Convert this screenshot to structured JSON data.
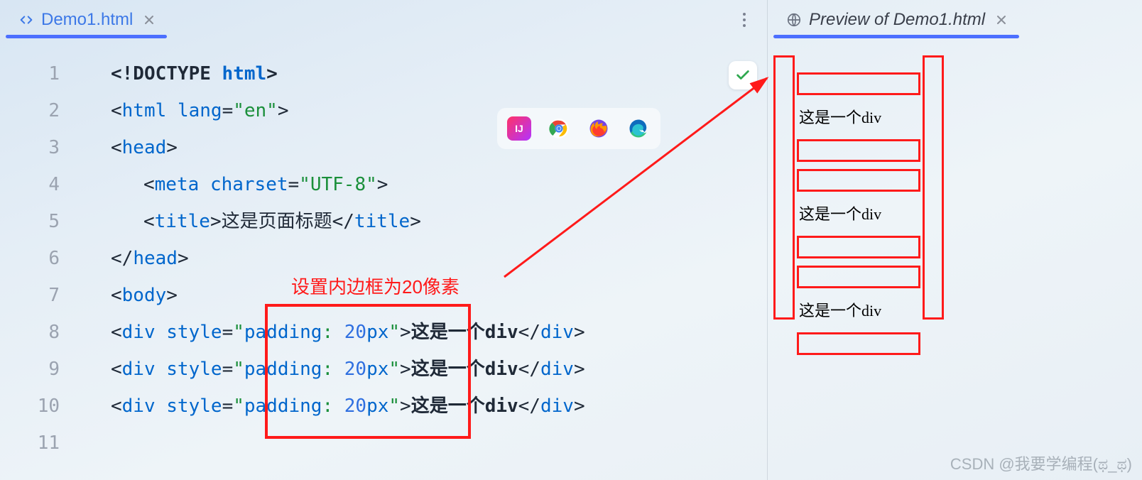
{
  "tabs": {
    "editor": {
      "title": "Demo1.html"
    },
    "preview": {
      "title": "Preview of Demo1.html"
    }
  },
  "gutter": [
    "1",
    "2",
    "3",
    "4",
    "5",
    "6",
    "7",
    "8",
    "9",
    "10",
    "11"
  ],
  "code": {
    "l1": {
      "a": "<!DOCTYPE ",
      "b": "html",
      "c": ">"
    },
    "l2": {
      "a": "<",
      "b": "html ",
      "c": "lang",
      "d": "=",
      "e": "\"en\"",
      "f": ">"
    },
    "l3": {
      "a": "<",
      "b": "head",
      "c": ">"
    },
    "l4": {
      "a": "<",
      "b": "meta ",
      "c": "charset",
      "d": "=",
      "e": "\"UTF-8\"",
      "f": ">"
    },
    "l5": {
      "a": "<",
      "b": "title",
      "c": ">",
      "t": "这是页面标题",
      "d": "</",
      "e": "title",
      "f": ">"
    },
    "l6": {
      "a": "</",
      "b": "head",
      "c": ">"
    },
    "l7": {
      "a": "<",
      "b": "body",
      "c": ">"
    },
    "l8": {
      "a": "<",
      "b": "div ",
      "c": "style",
      "d": "=",
      "e1": "\"",
      "prop": "padding",
      "colon": ": ",
      "val": "20",
      "unit": "px",
      "e2": "\"",
      "f": ">",
      "t": "这是一个div",
      "g": "</",
      "h": "div",
      "i": ">"
    },
    "l9": {
      "a": "<",
      "b": "div ",
      "c": "style",
      "d": "=",
      "e1": "\"",
      "prop": "padding",
      "colon": ": ",
      "val": "20",
      "unit": "px",
      "e2": "\"",
      "f": ">",
      "t": "这是一个div",
      "g": "</",
      "h": "div",
      "i": ">"
    },
    "l10": {
      "a": "<",
      "b": "div ",
      "c": "style",
      "d": "=",
      "e1": "\"",
      "prop": "padding",
      "colon": ": ",
      "val": "20",
      "unit": "px",
      "e2": "\"",
      "f": ">",
      "t": "这是一个div",
      "g": "</",
      "h": "div",
      "i": ">"
    }
  },
  "annotation": "设置内边框为20像素",
  "preview": {
    "items": [
      "这是一个div",
      "这是一个div",
      "这是一个div"
    ]
  },
  "watermark": "CSDN @我要学编程(ಥ_ಥ)"
}
